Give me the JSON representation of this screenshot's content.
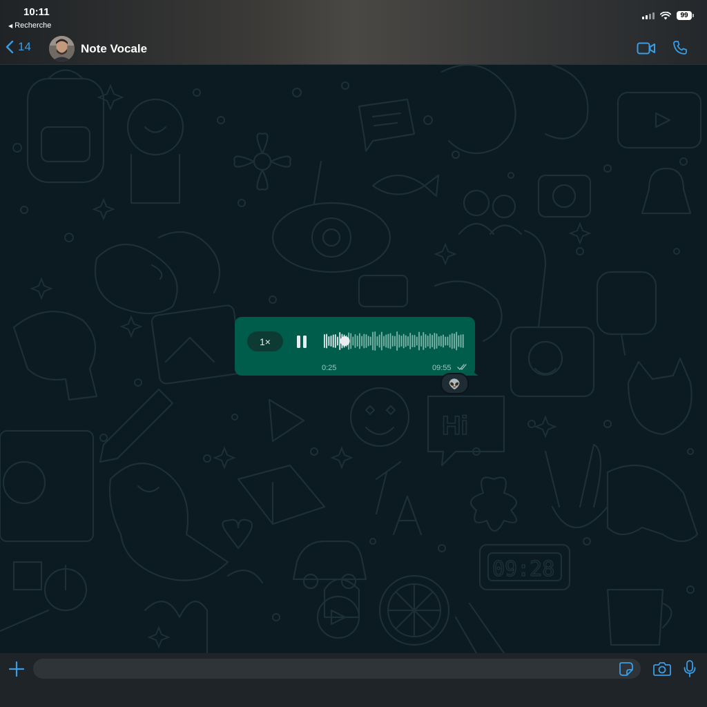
{
  "status_bar": {
    "time": "10:11",
    "back_app": "Recherche",
    "battery": "99"
  },
  "header": {
    "back_count": "14",
    "contact_name": "Note Vocale",
    "icons": [
      "chevron-left-icon",
      "video-call-icon",
      "phone-icon"
    ]
  },
  "voice_message": {
    "speed": "1×",
    "duration": "0:25",
    "time": "09:55",
    "progress": 0.15,
    "reaction": "👽",
    "status": "read"
  },
  "composer": {
    "placeholder": "",
    "icons": [
      "plus-icon",
      "sticker-icon",
      "camera-icon",
      "microphone-icon"
    ]
  },
  "colors": {
    "accent": "#3a9de6",
    "bubble": "#005c4b",
    "wallpaper": "#0c1a21"
  }
}
